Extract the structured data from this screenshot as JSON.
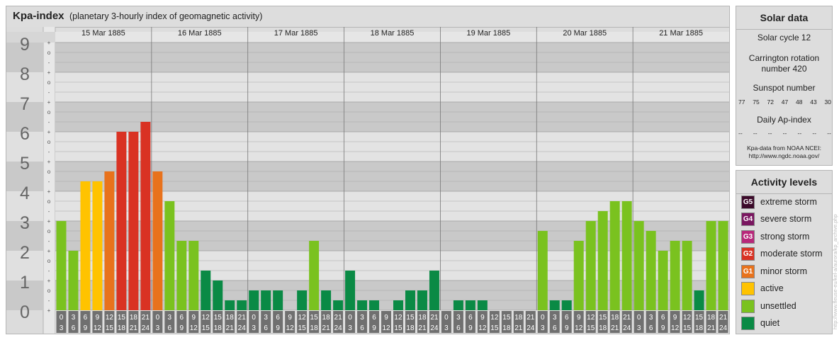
{
  "header": {
    "title": "Kpa-index",
    "subtitle": "(planetary 3-hourly index of geomagnetic activity)"
  },
  "chart_data": {
    "type": "bar",
    "title": "Kpa-index",
    "ylim": [
      0,
      9
    ],
    "y_major_ticks": [
      "0",
      "1",
      "2",
      "3",
      "4",
      "5",
      "6",
      "7",
      "8",
      "9"
    ],
    "y_minor_ticks": [
      "-",
      "o",
      "+"
    ],
    "days": [
      "15 Mar 1885",
      "16 Mar 1885",
      "17 Mar 1885",
      "18 Mar 1885",
      "19 Mar 1885",
      "20 Mar 1885",
      "21 Mar 1885"
    ],
    "interval_start_labels": [
      "0",
      "3",
      "6",
      "9",
      "12",
      "15",
      "18",
      "21"
    ],
    "interval_end_labels": [
      "3",
      "6",
      "9",
      "12",
      "15",
      "18",
      "21",
      "24"
    ],
    "values": [
      3.0,
      2.0,
      4.333,
      4.333,
      4.667,
      6.0,
      6.0,
      6.333,
      4.667,
      3.667,
      2.333,
      2.333,
      1.333,
      1.0,
      0.333,
      0.333,
      0.667,
      0.667,
      0.667,
      0.0,
      0.667,
      2.333,
      0.667,
      0.333,
      1.333,
      0.333,
      0.333,
      0.0,
      0.333,
      0.667,
      0.667,
      1.333,
      0.0,
      0.333,
      0.333,
      0.333,
      0.0,
      0.0,
      0.0,
      0.0,
      2.667,
      0.333,
      0.333,
      2.333,
      3.0,
      3.333,
      3.667,
      3.667,
      3.0,
      2.667,
      2.0,
      2.333,
      2.333,
      0.667,
      3.0,
      3.0
    ],
    "colors": {
      "quiet": "#0a8a45",
      "unsettled": "#7ac21f",
      "active": "#ffc300",
      "minor_storm": "#e8721c",
      "moderate_storm": "#d93223"
    }
  },
  "solar": {
    "title": "Solar data",
    "cycle": "Solar cycle 12",
    "carrington_1": "Carrington rotation",
    "carrington_2": "number 420",
    "sunspot_title": "Sunspot number",
    "sunspot_values": [
      "77",
      "75",
      "72",
      "47",
      "48",
      "43",
      "30"
    ],
    "ap_title": "Daily Ap-index",
    "ap_values": [
      "--",
      "--",
      "--",
      "--",
      "--",
      "--",
      "--"
    ],
    "source_1": "Kpa-data from NOAA NCEI:",
    "source_2": "http://www.ngdc.noaa.gov/"
  },
  "levels": {
    "title": "Activity levels",
    "items": [
      {
        "code": "G5",
        "label": "extreme storm",
        "color": "#3c0a2a"
      },
      {
        "code": "G4",
        "label": "severe storm",
        "color": "#7a1660"
      },
      {
        "code": "G3",
        "label": "strong storm",
        "color": "#b8287a"
      },
      {
        "code": "G2",
        "label": "moderate storm",
        "color": "#d93223"
      },
      {
        "code": "G1",
        "label": "minor storm",
        "color": "#e8721c"
      },
      {
        "code": "",
        "label": "active",
        "color": "#ffc300"
      },
      {
        "code": "",
        "label": "unsettled",
        "color": "#7ac21f"
      },
      {
        "code": "",
        "label": "quiet",
        "color": "#0a8a45"
      }
    ]
  },
  "watermark": "http://www.fleuse-eu/kel-a/aurora/kp_archive.php"
}
